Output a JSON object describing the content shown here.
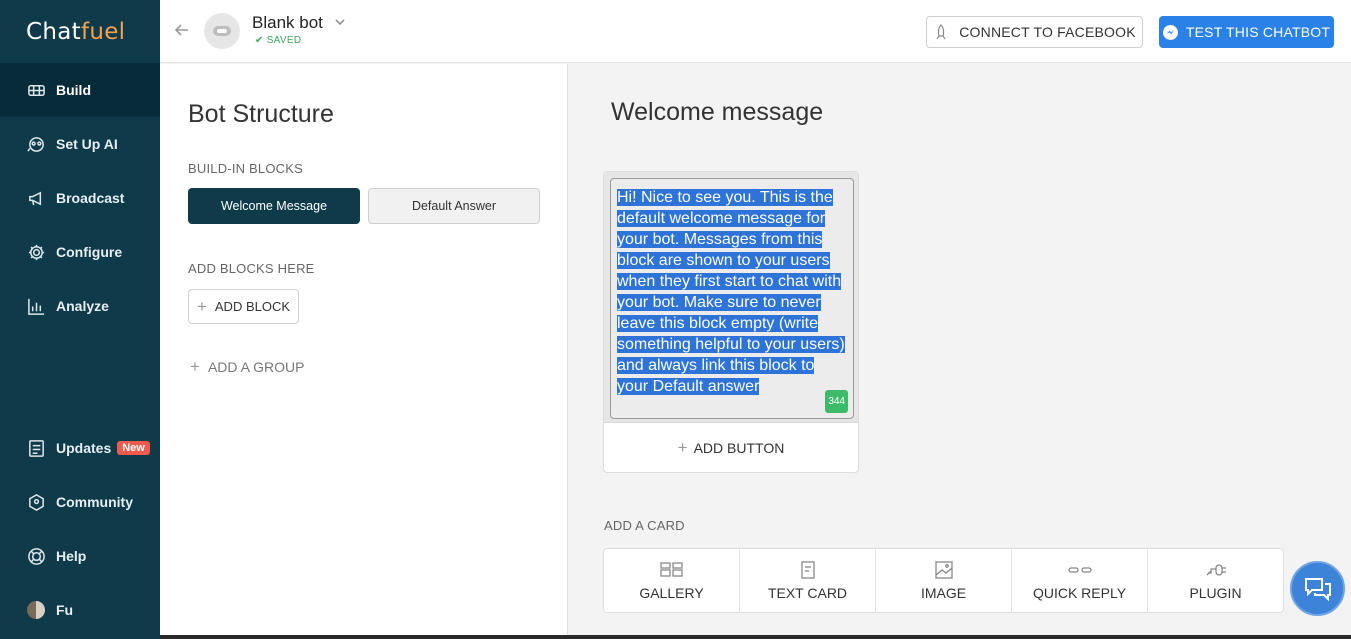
{
  "app": {
    "logo_part1": "Chat",
    "logo_part2": "fuel"
  },
  "sidebar": {
    "items": [
      {
        "label": "Build",
        "icon": "build-icon",
        "active": true
      },
      {
        "label": "Set Up AI",
        "icon": "ai-icon"
      },
      {
        "label": "Broadcast",
        "icon": "megaphone-icon"
      },
      {
        "label": "Configure",
        "icon": "gear-icon"
      },
      {
        "label": "Analyze",
        "icon": "chart-icon"
      },
      {
        "label": "Updates",
        "icon": "updates-icon",
        "badge": "New"
      },
      {
        "label": "Community",
        "icon": "community-icon"
      },
      {
        "label": "Help",
        "icon": "lifebuoy-icon"
      },
      {
        "label": "Fu",
        "icon": "user-avatar"
      }
    ]
  },
  "header": {
    "bot_name": "Blank bot",
    "status": "SAVED",
    "connect_label": "CONNECT TO FACEBOOK",
    "test_label": "TEST THIS CHATBOT"
  },
  "structure": {
    "title": "Bot Structure",
    "builtin_label": "BUILD-IN BLOCKS",
    "welcome_block": "Welcome Message",
    "default_block": "Default Answer",
    "add_blocks_label": "ADD BLOCKS HERE",
    "add_block_button": "ADD BLOCK",
    "add_group_button": "ADD A GROUP"
  },
  "main": {
    "title": "Welcome message",
    "message_text": "Hi! Nice to see you. This is the default welcome message for your bot. Messages from this block are shown to your users when they first start to chat with your bot. Make sure to never leave this block empty (write something helpful to your users) and always link this block to your Default answer",
    "char_count": "344",
    "add_button": "ADD BUTTON",
    "add_card_label": "ADD A CARD",
    "card_types": [
      "GALLERY",
      "TEXT CARD",
      "IMAGE",
      "QUICK REPLY",
      "PLUGIN"
    ]
  },
  "colors": {
    "sidebar": "#0e3a4a",
    "accent_blue": "#2a82e8",
    "selection": "#2d73d8",
    "new_badge": "#ee5a4d"
  }
}
